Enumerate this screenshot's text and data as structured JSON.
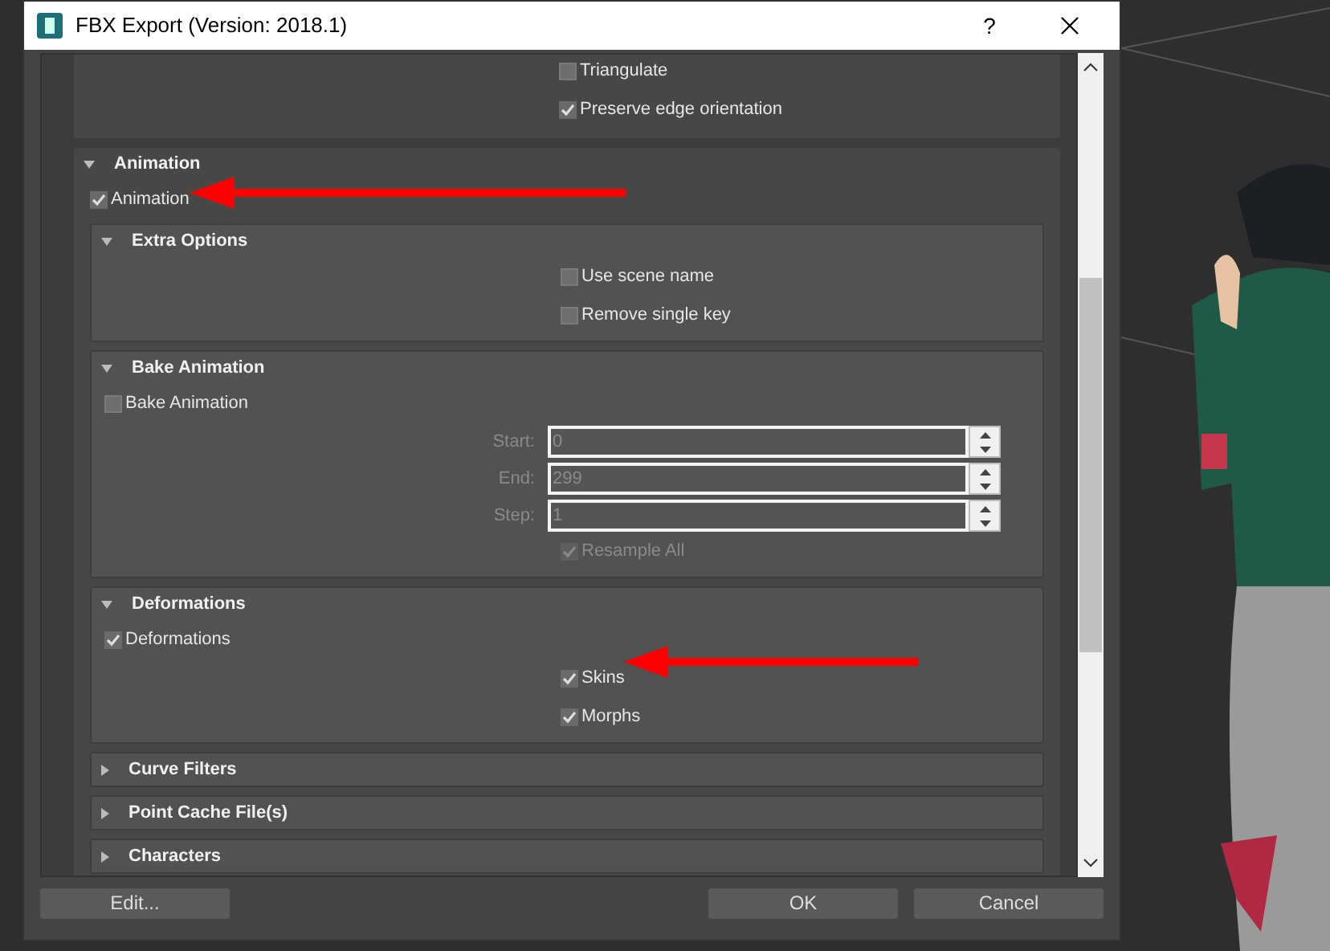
{
  "window": {
    "title": "FBX Export (Version: 2018.1)",
    "help": "?"
  },
  "geometry_options": [
    {
      "label": "Triangulate",
      "checked": false
    },
    {
      "label": "Preserve edge orientation",
      "checked": true
    }
  ],
  "animation": {
    "title": "Animation",
    "expanded": true,
    "checkbox": {
      "label": "Animation",
      "checked": true
    },
    "sections": [
      {
        "kind": "options",
        "title": "Extra Options",
        "expanded": true,
        "items": [
          {
            "label": "Use scene name",
            "checked": false
          },
          {
            "label": "Remove single key",
            "checked": false
          }
        ]
      },
      {
        "kind": "bake",
        "title": "Bake Animation",
        "expanded": true,
        "checkbox": {
          "label": "Bake Animation",
          "checked": false
        },
        "fields": [
          {
            "label": "Start:",
            "value": "0",
            "disabled": true
          },
          {
            "label": "End:",
            "value": "299",
            "disabled": true
          },
          {
            "label": "Step:",
            "value": "1",
            "disabled": true
          }
        ],
        "resample": {
          "label": "Resample All",
          "checked": true,
          "disabled": true
        }
      },
      {
        "kind": "options",
        "title": "Deformations",
        "expanded": true,
        "checkbox": {
          "label": "Deformations",
          "checked": true
        },
        "items": [
          {
            "label": "Skins",
            "checked": true
          },
          {
            "label": "Morphs",
            "checked": true
          }
        ]
      },
      {
        "kind": "collapsed",
        "title": "Curve Filters",
        "expanded": false
      },
      {
        "kind": "collapsed",
        "title": "Point Cache File(s)",
        "expanded": false
      },
      {
        "kind": "collapsed",
        "title": "Characters",
        "expanded": false
      }
    ]
  },
  "buttons": [
    {
      "label": "Edit..."
    },
    {
      "label": "OK"
    },
    {
      "label": "Cancel"
    }
  ]
}
